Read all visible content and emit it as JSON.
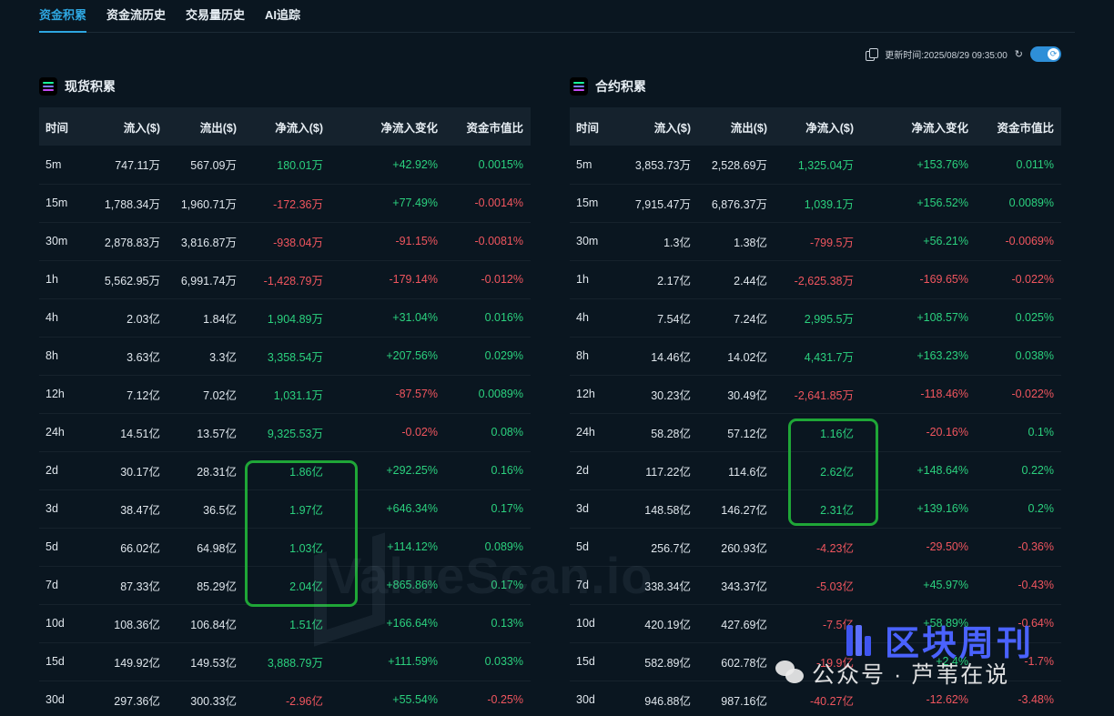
{
  "tabs": [
    "资金积累",
    "资金流历史",
    "交易量历史",
    "AI追踪"
  ],
  "toolbar": {
    "update_label": "更新时间:2025/08/29 09:35:00",
    "copy_icon": "copy-icon",
    "refresh_icon": "refresh-icon",
    "toggle_on": true
  },
  "colors": {
    "accent": "#2ea6e0",
    "positive": "#2bd17e",
    "negative": "#f0555e",
    "highlight": "#1fa637"
  },
  "columns": [
    "时间",
    "流入($)",
    "流出($)",
    "净流入($)",
    "净流入变化",
    "资金市值比"
  ],
  "spot": {
    "title": "现货积累",
    "rows": [
      [
        "5m",
        "747.11万",
        "567.09万",
        "180.01万",
        "+42.92%",
        "0.0015%"
      ],
      [
        "15m",
        "1,788.34万",
        "1,960.71万",
        "-172.36万",
        "+77.49%",
        "-0.0014%"
      ],
      [
        "30m",
        "2,878.83万",
        "3,816.87万",
        "-938.04万",
        "-91.15%",
        "-0.0081%"
      ],
      [
        "1h",
        "5,562.95万",
        "6,991.74万",
        "-1,428.79万",
        "-179.14%",
        "-0.012%"
      ],
      [
        "4h",
        "2.03亿",
        "1.84亿",
        "1,904.89万",
        "+31.04%",
        "0.016%"
      ],
      [
        "8h",
        "3.63亿",
        "3.3亿",
        "3,358.54万",
        "+207.56%",
        "0.029%"
      ],
      [
        "12h",
        "7.12亿",
        "7.02亿",
        "1,031.1万",
        "-87.57%",
        "0.0089%"
      ],
      [
        "24h",
        "14.51亿",
        "13.57亿",
        "9,325.53万",
        "-0.02%",
        "0.08%"
      ],
      [
        "2d",
        "30.17亿",
        "28.31亿",
        "1.86亿",
        "+292.25%",
        "0.16%"
      ],
      [
        "3d",
        "38.47亿",
        "36.5亿",
        "1.97亿",
        "+646.34%",
        "0.17%"
      ],
      [
        "5d",
        "66.02亿",
        "64.98亿",
        "1.03亿",
        "+114.12%",
        "0.089%"
      ],
      [
        "7d",
        "87.33亿",
        "85.29亿",
        "2.04亿",
        "+865.86%",
        "0.17%"
      ],
      [
        "10d",
        "108.36亿",
        "106.84亿",
        "1.51亿",
        "+166.64%",
        "0.13%"
      ],
      [
        "15d",
        "149.92亿",
        "149.53亿",
        "3,888.79万",
        "+111.59%",
        "0.033%"
      ],
      [
        "30d",
        "297.36亿",
        "300.33亿",
        "-2.96亿",
        "+55.54%",
        "-0.25%"
      ]
    ]
  },
  "futures": {
    "title": "合约积累",
    "rows": [
      [
        "5m",
        "3,853.73万",
        "2,528.69万",
        "1,325.04万",
        "+153.76%",
        "0.011%"
      ],
      [
        "15m",
        "7,915.47万",
        "6,876.37万",
        "1,039.1万",
        "+156.52%",
        "0.0089%"
      ],
      [
        "30m",
        "1.3亿",
        "1.38亿",
        "-799.5万",
        "+56.21%",
        "-0.0069%"
      ],
      [
        "1h",
        "2.17亿",
        "2.44亿",
        "-2,625.38万",
        "-169.65%",
        "-0.022%"
      ],
      [
        "4h",
        "7.54亿",
        "7.24亿",
        "2,995.5万",
        "+108.57%",
        "0.025%"
      ],
      [
        "8h",
        "14.46亿",
        "14.02亿",
        "4,431.7万",
        "+163.23%",
        "0.038%"
      ],
      [
        "12h",
        "30.23亿",
        "30.49亿",
        "-2,641.85万",
        "-118.46%",
        "-0.022%"
      ],
      [
        "24h",
        "58.28亿",
        "57.12亿",
        "1.16亿",
        "-20.16%",
        "0.1%"
      ],
      [
        "2d",
        "117.22亿",
        "114.6亿",
        "2.62亿",
        "+148.64%",
        "0.22%"
      ],
      [
        "3d",
        "148.58亿",
        "146.27亿",
        "2.31亿",
        "+139.16%",
        "0.2%"
      ],
      [
        "5d",
        "256.7亿",
        "260.93亿",
        "-4.23亿",
        "-29.50%",
        "-0.36%"
      ],
      [
        "7d",
        "338.34亿",
        "343.37亿",
        "-5.03亿",
        "+45.97%",
        "-0.43%"
      ],
      [
        "10d",
        "420.19亿",
        "427.69亿",
        "-7.5亿",
        "+58.89%",
        "-0.64%"
      ],
      [
        "15d",
        "582.89亿",
        "602.78亿",
        "-19.9亿",
        "+2.4%",
        "-1.7%"
      ],
      [
        "30d",
        "946.88亿",
        "987.16亿",
        "-40.27亿",
        "-12.62%",
        "-3.48%"
      ]
    ]
  },
  "watermark": "ValueScan.io",
  "brand_text": "区块周刊",
  "wechat_text": "公众号 · 芦苇在说"
}
